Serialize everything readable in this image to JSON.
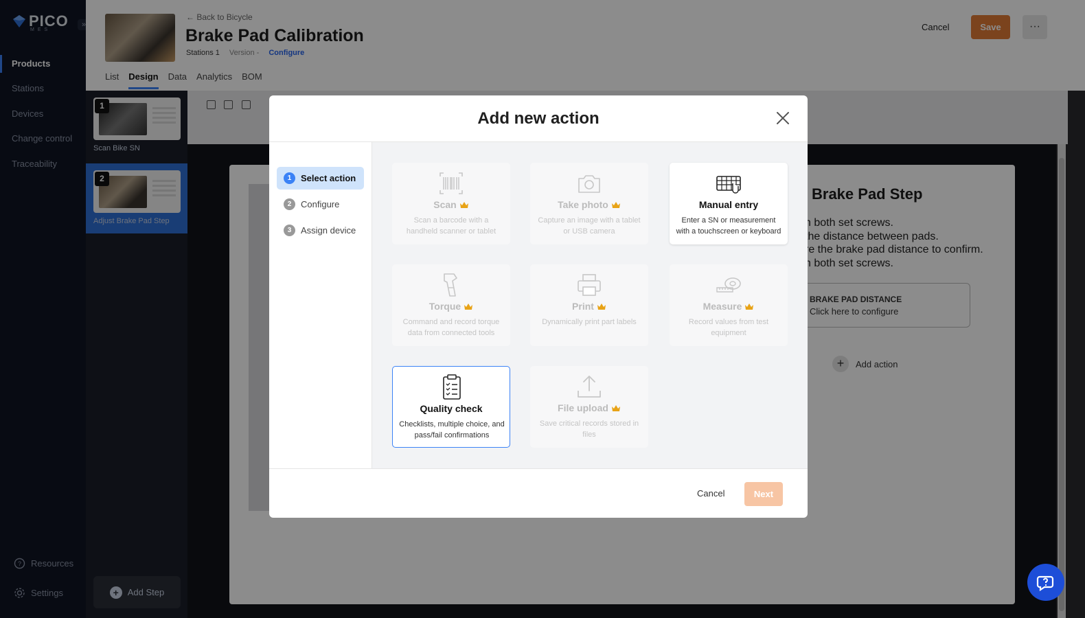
{
  "sidebar": {
    "logo_text": "PICO",
    "logo_sub": "MES",
    "nav": [
      {
        "label": "Products",
        "active": true
      },
      {
        "label": "Stations"
      },
      {
        "label": "Devices"
      },
      {
        "label": "Change control"
      },
      {
        "label": "Traceability"
      }
    ],
    "resources_label": "Resources",
    "settings_label": "Settings"
  },
  "header": {
    "back_label": "Back to Bicycle",
    "title": "Brake Pad Calibration",
    "stations_label": "Stations 1",
    "version_label": "Version -",
    "configure_label": "Configure",
    "tabs": [
      "List",
      "Design",
      "Data",
      "Analytics",
      "BOM"
    ],
    "active_tab": "Design",
    "cancel_label": "Cancel",
    "save_label": "Save",
    "more_label": "···"
  },
  "steps": [
    {
      "number": "1",
      "label": "Scan Bike SN"
    },
    {
      "number": "2",
      "label": "Adjust Brake Pad Step"
    }
  ],
  "add_step_label": "Add Step",
  "canvas": {
    "step_title": "Brake Pad Step",
    "instructions": [
      "n both set screws.",
      " the distance between pads.",
      "re the brake pad distance to confirm.",
      "n both set screws."
    ],
    "field_title": "BRAKE PAD DISTANCE",
    "field_sub": "Click here to configure",
    "add_action_label": "Add action"
  },
  "modal": {
    "title": "Add new action",
    "wizard": [
      {
        "num": "1",
        "label": "Select action",
        "active": true
      },
      {
        "num": "2",
        "label": "Configure"
      },
      {
        "num": "3",
        "label": "Assign device"
      }
    ],
    "actions": [
      {
        "title": "Scan",
        "desc": "Scan a barcode with a handheld scanner or tablet",
        "icon": "barcode-icon",
        "premium": true,
        "state": "disabled"
      },
      {
        "title": "Take photo",
        "desc": "Capture an image with a tablet or USB camera",
        "icon": "camera-icon",
        "premium": true,
        "state": "disabled"
      },
      {
        "title": "Manual entry",
        "desc": "Enter a SN or measurement with a touchscreen or keyboard",
        "icon": "keyboard-icon",
        "premium": false,
        "state": "enabled"
      },
      {
        "title": "Torque",
        "desc": "Command and record torque data from connected tools",
        "icon": "torque-tool-icon",
        "premium": true,
        "state": "disabled"
      },
      {
        "title": "Print",
        "desc": "Dynamically print part labels",
        "icon": "printer-icon",
        "premium": true,
        "state": "disabled"
      },
      {
        "title": "Measure",
        "desc": "Record values from test equipment",
        "icon": "tape-measure-icon",
        "premium": true,
        "state": "disabled"
      },
      {
        "title": "Quality check",
        "desc": "Checklists, multiple choice, and pass/fail confirmations",
        "icon": "clipboard-checklist-icon",
        "premium": false,
        "state": "selected"
      },
      {
        "title": "File upload",
        "desc": "Save critical records stored in files",
        "icon": "upload-icon",
        "premium": true,
        "state": "disabled"
      }
    ],
    "cancel_label": "Cancel",
    "next_label": "Next"
  },
  "colors": {
    "accent": "#3b82f6",
    "save": "#e07a35",
    "next_disabled": "#f7c5a4",
    "crown": "#e8a317"
  }
}
